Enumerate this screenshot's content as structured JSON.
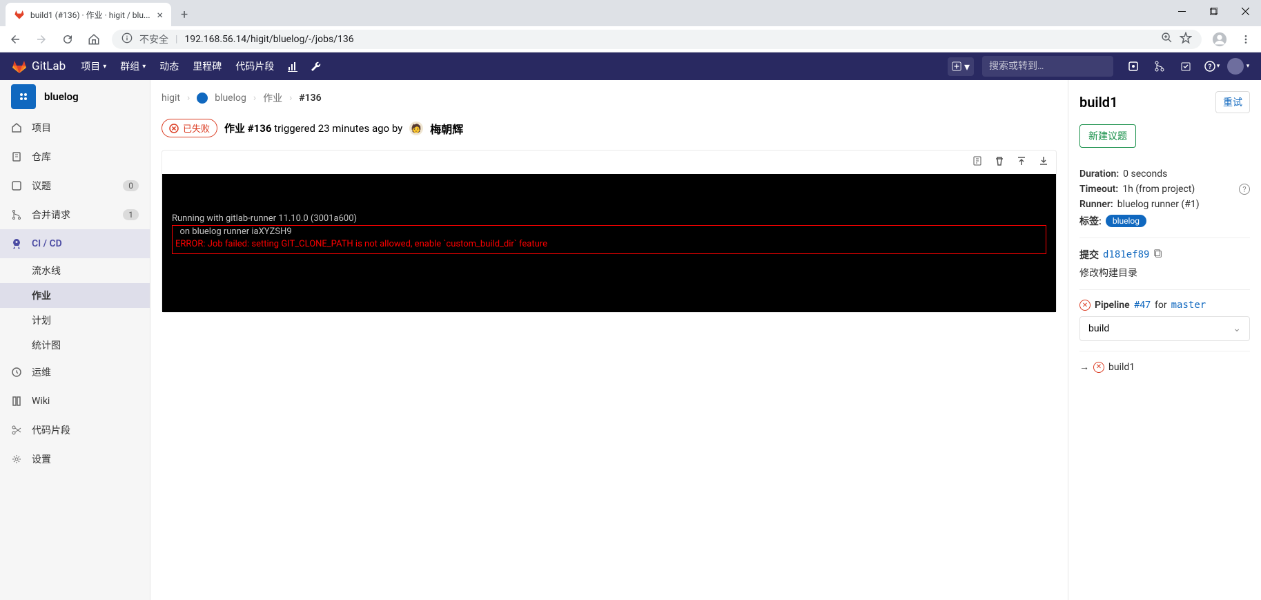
{
  "browser": {
    "tab_title": "build1 (#136) · 作业 · higit / blu...",
    "not_secure_label": "不安全",
    "url_display": "192.168.56.14/higit/bluelog/-/jobs/136"
  },
  "navbar": {
    "brand": "GitLab",
    "items": [
      "项目",
      "群组",
      "动态",
      "里程碑",
      "代码片段"
    ],
    "search_placeholder": "搜索或转到…"
  },
  "sidebar": {
    "project_name": "bluelog",
    "items": [
      {
        "label": "项目",
        "icon": "home"
      },
      {
        "label": "仓库",
        "icon": "repo"
      },
      {
        "label": "议题",
        "icon": "issues",
        "badge": "0"
      },
      {
        "label": "合并请求",
        "icon": "merge",
        "badge": "1"
      },
      {
        "label": "CI / CD",
        "icon": "rocket",
        "active": true
      },
      {
        "label": "运维",
        "icon": "ops"
      },
      {
        "label": "Wiki",
        "icon": "book"
      },
      {
        "label": "代码片段",
        "icon": "scissors"
      },
      {
        "label": "设置",
        "icon": "gear"
      }
    ],
    "cicd_sub": [
      {
        "label": "流水线"
      },
      {
        "label": "作业",
        "active": true
      },
      {
        "label": "计划"
      },
      {
        "label": "统计图"
      }
    ]
  },
  "breadcrumb": {
    "p1": "higit",
    "p2": "bluelog",
    "p3": "作业",
    "p4": "#136"
  },
  "job": {
    "status_label": "已失败",
    "title_prefix": "作业 #136",
    "triggered_text": "triggered 23 minutes ago by",
    "author": "梅朝辉"
  },
  "log": {
    "line1": "Running with gitlab-runner 11.10.0 (3001a600)",
    "line2": "  on bluelog runner iaXYZSH9",
    "error": "ERROR: Job failed: setting GIT_CLONE_PATH is not allowed, enable `custom_build_dir` feature"
  },
  "right": {
    "title": "build1",
    "retry_btn": "重试",
    "new_issue_btn": "新建议题",
    "duration_label": "Duration:",
    "duration_value": "0 seconds",
    "timeout_label": "Timeout:",
    "timeout_value": "1h (from project)",
    "runner_label": "Runner:",
    "runner_value": "bluelog runner (#1)",
    "tags_label": "标签:",
    "tags_value": "bluelog",
    "commit_label": "提交",
    "commit_sha": "d181ef89",
    "commit_msg": "修改构建目录",
    "pipeline_label": "Pipeline",
    "pipeline_num": "#47",
    "pipeline_for": "for",
    "pipeline_branch": "master",
    "stage_select": "build",
    "job_name": "build1"
  }
}
